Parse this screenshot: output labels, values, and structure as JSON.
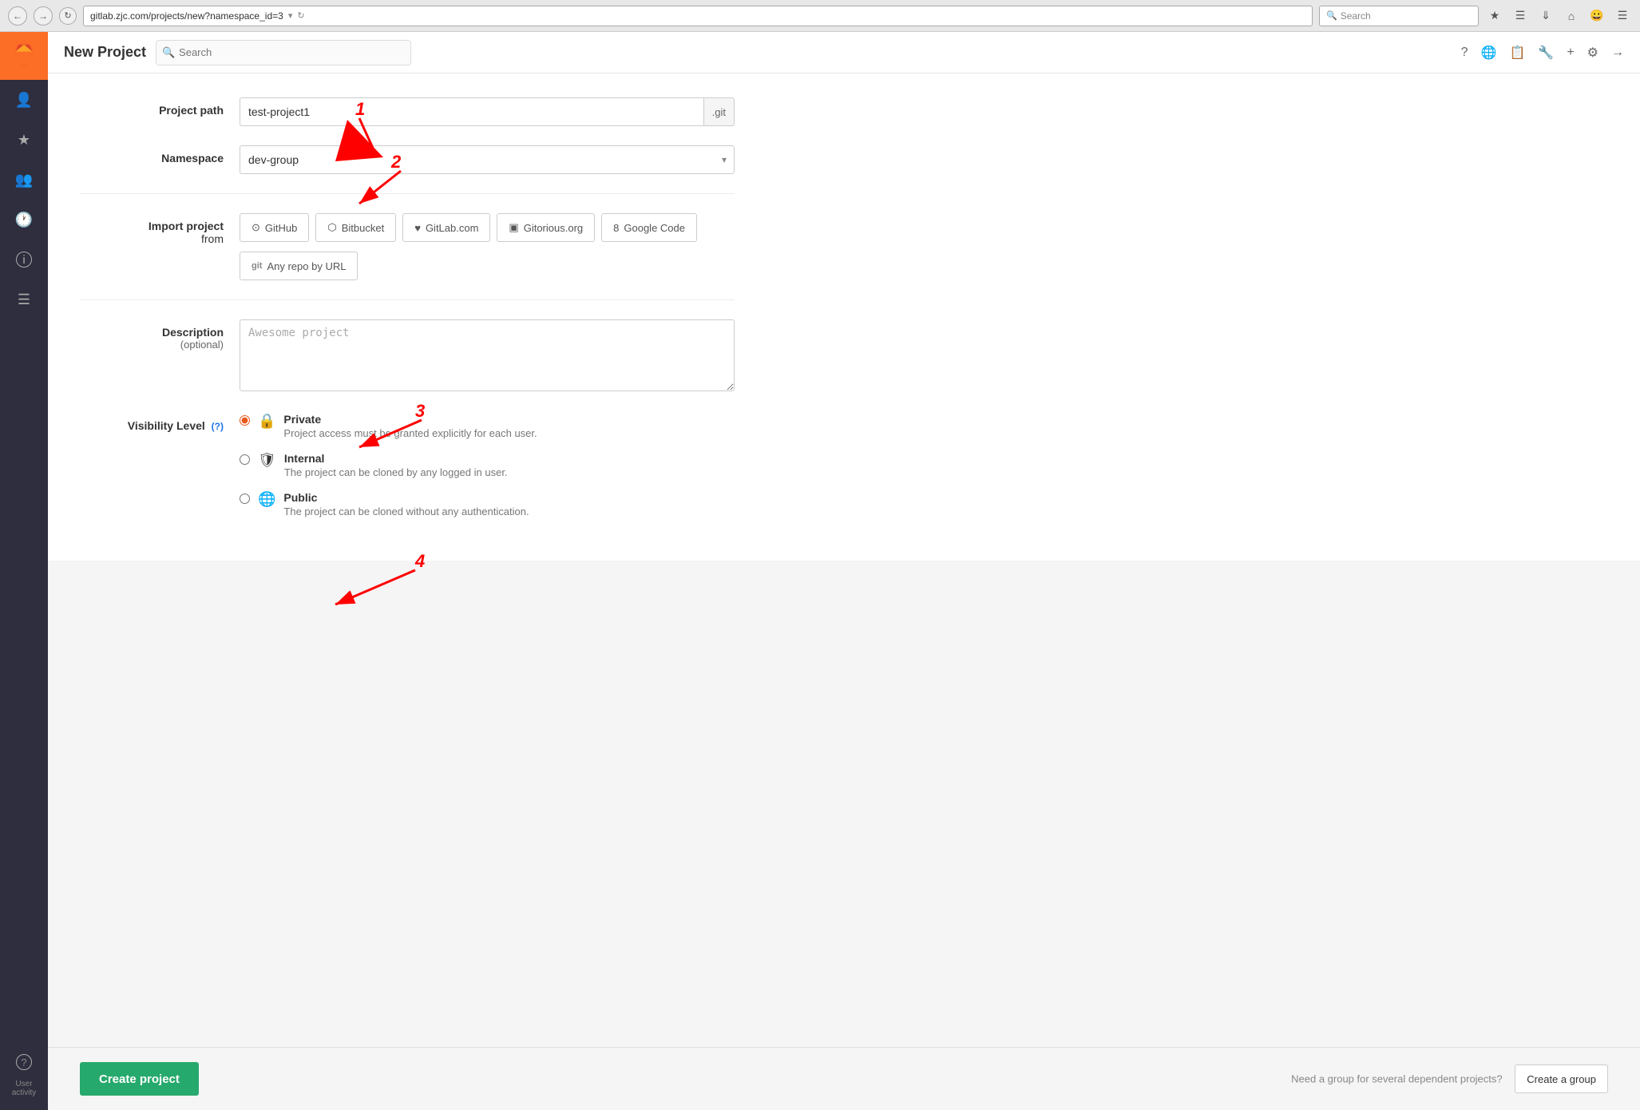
{
  "browser": {
    "url": "gitlab.zjc.com/projects/new?namespace_id=3",
    "search_placeholder": "Search",
    "nav_back_title": "←",
    "refresh_title": "↻",
    "dropdown_title": "▾"
  },
  "header": {
    "title": "New Project",
    "search_placeholder": "Search"
  },
  "topbar_icons": {
    "help": "?",
    "globe": "🌐",
    "clipboard": "📋",
    "wrench": "🔧",
    "plus": "+",
    "settings": "⚙",
    "signout": "→"
  },
  "sidebar": {
    "items": [
      {
        "name": "profile",
        "icon": "👤"
      },
      {
        "name": "starred",
        "icon": "★"
      },
      {
        "name": "groups",
        "icon": "👥"
      },
      {
        "name": "activity",
        "icon": "🕐"
      },
      {
        "name": "info",
        "icon": "ℹ"
      },
      {
        "name": "list",
        "icon": "☰"
      },
      {
        "name": "help",
        "icon": "?"
      }
    ],
    "bottom": {
      "user_label": "User",
      "activity_label": "activity"
    }
  },
  "form": {
    "project_path_label": "Project path",
    "project_path_value": "test-project1",
    "project_path_suffix": ".git",
    "namespace_label": "Namespace",
    "namespace_value": "dev-group",
    "import_label": "Import project",
    "import_label_sub": "from",
    "import_buttons": [
      {
        "icon": "⊙",
        "label": "GitHub"
      },
      {
        "icon": "⬡",
        "label": "Bitbucket"
      },
      {
        "icon": "♥",
        "label": "GitLab.com"
      },
      {
        "icon": "▣",
        "label": "Gitorious.org"
      },
      {
        "icon": "8",
        "label": "Google Code"
      },
      {
        "icon": "git",
        "label": "Any repo by URL"
      }
    ],
    "description_label": "Description",
    "description_sublabel": "(optional)",
    "description_placeholder": "Awesome project",
    "visibility_label": "Visibility Level",
    "visibility_help": "(?)",
    "visibility_options": [
      {
        "value": "private",
        "label": "Private",
        "icon": "🔒",
        "description": "Project access must be granted explicitly for each user.",
        "checked": true
      },
      {
        "value": "internal",
        "label": "Internal",
        "icon": "🛡",
        "description": "The project can be cloned by any logged in user.",
        "checked": false
      },
      {
        "value": "public",
        "label": "Public",
        "icon": "🌐",
        "description": "The project can be cloned without any authentication.",
        "checked": false
      }
    ]
  },
  "footer": {
    "create_button_label": "Create project",
    "note_text": "Need a group for several dependent projects?",
    "create_group_label": "Create a group"
  },
  "annotations": {
    "1": "1",
    "2": "2",
    "3": "3",
    "4": "4"
  }
}
